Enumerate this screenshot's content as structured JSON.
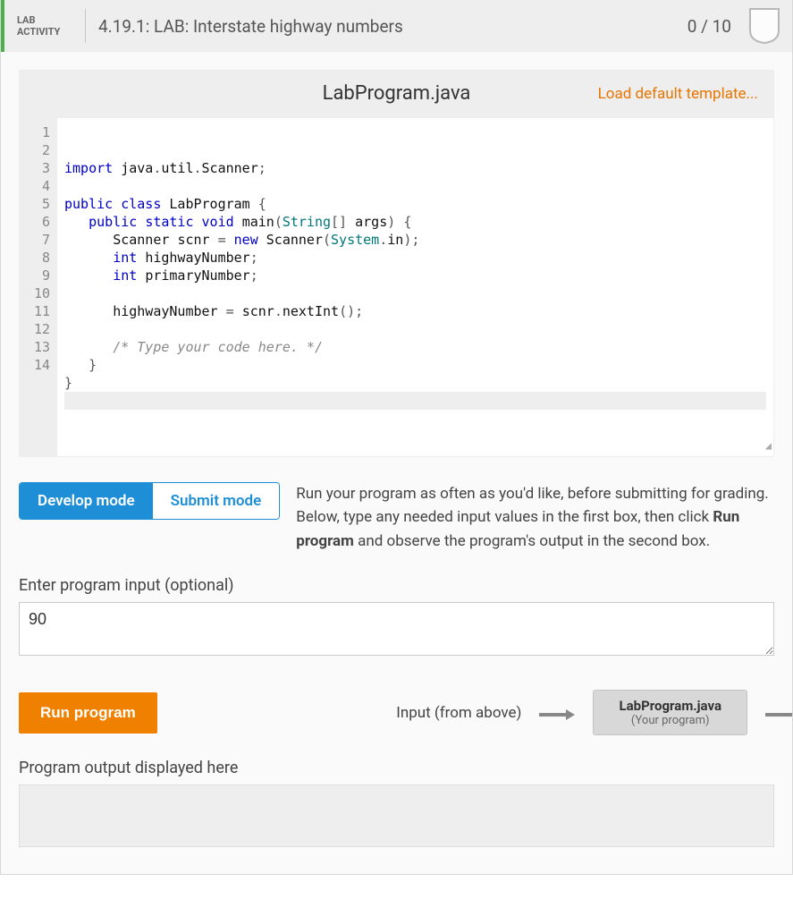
{
  "header": {
    "badge_line1": "LAB",
    "badge_line2": "ACTIVITY",
    "title": "4.19.1: LAB: Interstate highway numbers",
    "score": "0 / 10"
  },
  "editor": {
    "filename": "LabProgram.java",
    "load_template_label": "Load default template...",
    "line_count": 14,
    "active_line": 14,
    "code_tokens": [
      [
        [
          "kw",
          "import"
        ],
        [
          "sp",
          " "
        ],
        [
          "id",
          "java"
        ],
        [
          "op",
          "."
        ],
        [
          "id",
          "util"
        ],
        [
          "op",
          "."
        ],
        [
          "id",
          "Scanner"
        ],
        [
          "op",
          ";"
        ]
      ],
      [],
      [
        [
          "kw",
          "public"
        ],
        [
          "sp",
          " "
        ],
        [
          "kw",
          "class"
        ],
        [
          "sp",
          " "
        ],
        [
          "id",
          "LabProgram"
        ],
        [
          "sp",
          " "
        ],
        [
          "op",
          "{"
        ]
      ],
      [
        [
          "sp",
          "   "
        ],
        [
          "kw",
          "public"
        ],
        [
          "sp",
          " "
        ],
        [
          "kw",
          "static"
        ],
        [
          "sp",
          " "
        ],
        [
          "kw",
          "void"
        ],
        [
          "sp",
          " "
        ],
        [
          "id",
          "main"
        ],
        [
          "op",
          "("
        ],
        [
          "type",
          "String"
        ],
        [
          "op",
          "[]"
        ],
        [
          "sp",
          " "
        ],
        [
          "id",
          "args"
        ],
        [
          "op",
          ")"
        ],
        [
          "sp",
          " "
        ],
        [
          "op",
          "{"
        ]
      ],
      [
        [
          "sp",
          "      "
        ],
        [
          "id",
          "Scanner"
        ],
        [
          "sp",
          " "
        ],
        [
          "id",
          "scnr"
        ],
        [
          "sp",
          " "
        ],
        [
          "op",
          "="
        ],
        [
          "sp",
          " "
        ],
        [
          "kw",
          "new"
        ],
        [
          "sp",
          " "
        ],
        [
          "id",
          "Scanner"
        ],
        [
          "op",
          "("
        ],
        [
          "type",
          "System"
        ],
        [
          "op",
          "."
        ],
        [
          "id",
          "in"
        ],
        [
          "op",
          ");"
        ]
      ],
      [
        [
          "sp",
          "      "
        ],
        [
          "kw",
          "int"
        ],
        [
          "sp",
          " "
        ],
        [
          "id",
          "highwayNumber"
        ],
        [
          "op",
          ";"
        ]
      ],
      [
        [
          "sp",
          "      "
        ],
        [
          "kw",
          "int"
        ],
        [
          "sp",
          " "
        ],
        [
          "id",
          "primaryNumber"
        ],
        [
          "op",
          ";"
        ]
      ],
      [],
      [
        [
          "sp",
          "      "
        ],
        [
          "id",
          "highwayNumber"
        ],
        [
          "sp",
          " "
        ],
        [
          "op",
          "="
        ],
        [
          "sp",
          " "
        ],
        [
          "id",
          "scnr"
        ],
        [
          "op",
          "."
        ],
        [
          "id",
          "nextInt"
        ],
        [
          "op",
          "();"
        ]
      ],
      [],
      [
        [
          "sp",
          "      "
        ],
        [
          "cmt",
          "/* Type your code here. */"
        ]
      ],
      [
        [
          "sp",
          "   "
        ],
        [
          "op",
          "}"
        ]
      ],
      [
        [
          "op",
          "}"
        ]
      ],
      []
    ]
  },
  "modes": {
    "develop_label": "Develop mode",
    "submit_label": "Submit mode",
    "active": "develop",
    "description_pre": "Run your program as often as you'd like, before submitting for grading. Below, type any needed input values in the first box, then click ",
    "description_bold": "Run program",
    "description_post": " and observe the program's output in the second box."
  },
  "input": {
    "label": "Enter program input (optional)",
    "value": "90"
  },
  "run": {
    "button_label": "Run program",
    "flow_input_label": "Input (from above)",
    "program_title": "LabProgram.java",
    "program_sub": "(Your program)"
  },
  "output": {
    "label": "Program output displayed here"
  }
}
